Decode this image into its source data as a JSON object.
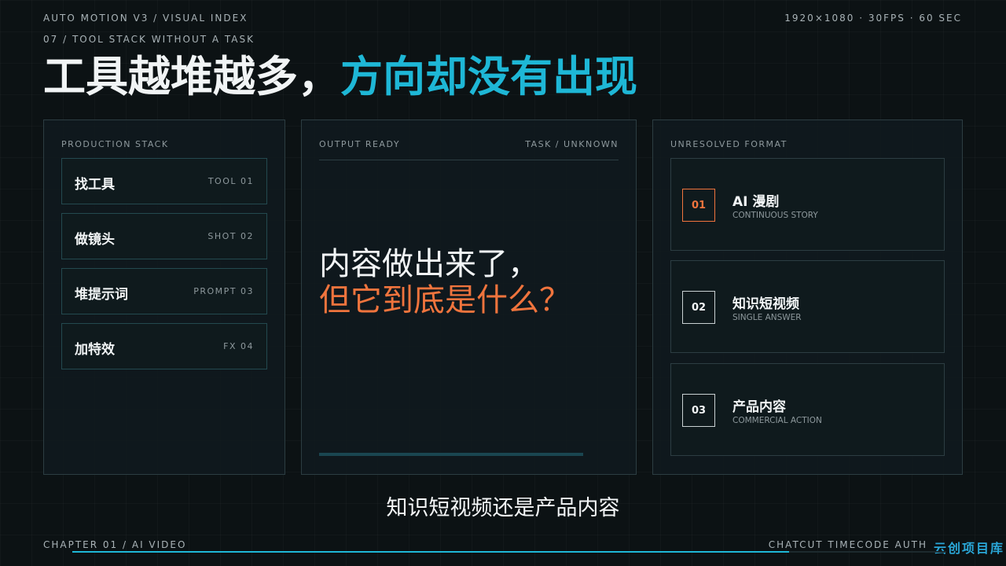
{
  "header": {
    "series": "AUTO MOTION V3 / VISUAL INDEX",
    "section": "07 / TOOL STACK WITHOUT A TASK",
    "specs": "1920×1080 · 30FPS · 60 SEC",
    "headline_a": "工具越堆越多，",
    "headline_b": "方向却没有出现",
    "colors": {
      "accent": "#1eb7d6",
      "warning": "#f0743d",
      "background": "#0c1214"
    }
  },
  "production_stack": {
    "label": "PRODUCTION STACK",
    "items": [
      {
        "name": "找工具",
        "code": "TOOL 01"
      },
      {
        "name": "做镜头",
        "code": "SHOT 02"
      },
      {
        "name": "堆提示词",
        "code": "PROMPT 03"
      },
      {
        "name": "加特效",
        "code": "FX 04"
      }
    ]
  },
  "output": {
    "label": "OUTPUT READY",
    "task": "TASK / UNKNOWN",
    "line1": "内容做出来了，",
    "line2": "但它到底是什么？"
  },
  "unresolved": {
    "label": "UNRESOLVED FORMAT",
    "items": [
      {
        "num": "01",
        "title": "AI 漫剧",
        "sub": "CONTINUOUS STORY",
        "active": true
      },
      {
        "num": "02",
        "title": "知识短视频",
        "sub": "SINGLE ANSWER",
        "active": false
      },
      {
        "num": "03",
        "title": "产品内容",
        "sub": "COMMERCIAL ACTION",
        "active": false
      }
    ]
  },
  "caption": "知识短视频还是产品内容",
  "footer": {
    "chapter": "CHAPTER 01 / AI VIDEO",
    "credit": "CHATCUT TIMECODE AUTH",
    "watermark": "云创项目库",
    "progress_percent": 82
  }
}
